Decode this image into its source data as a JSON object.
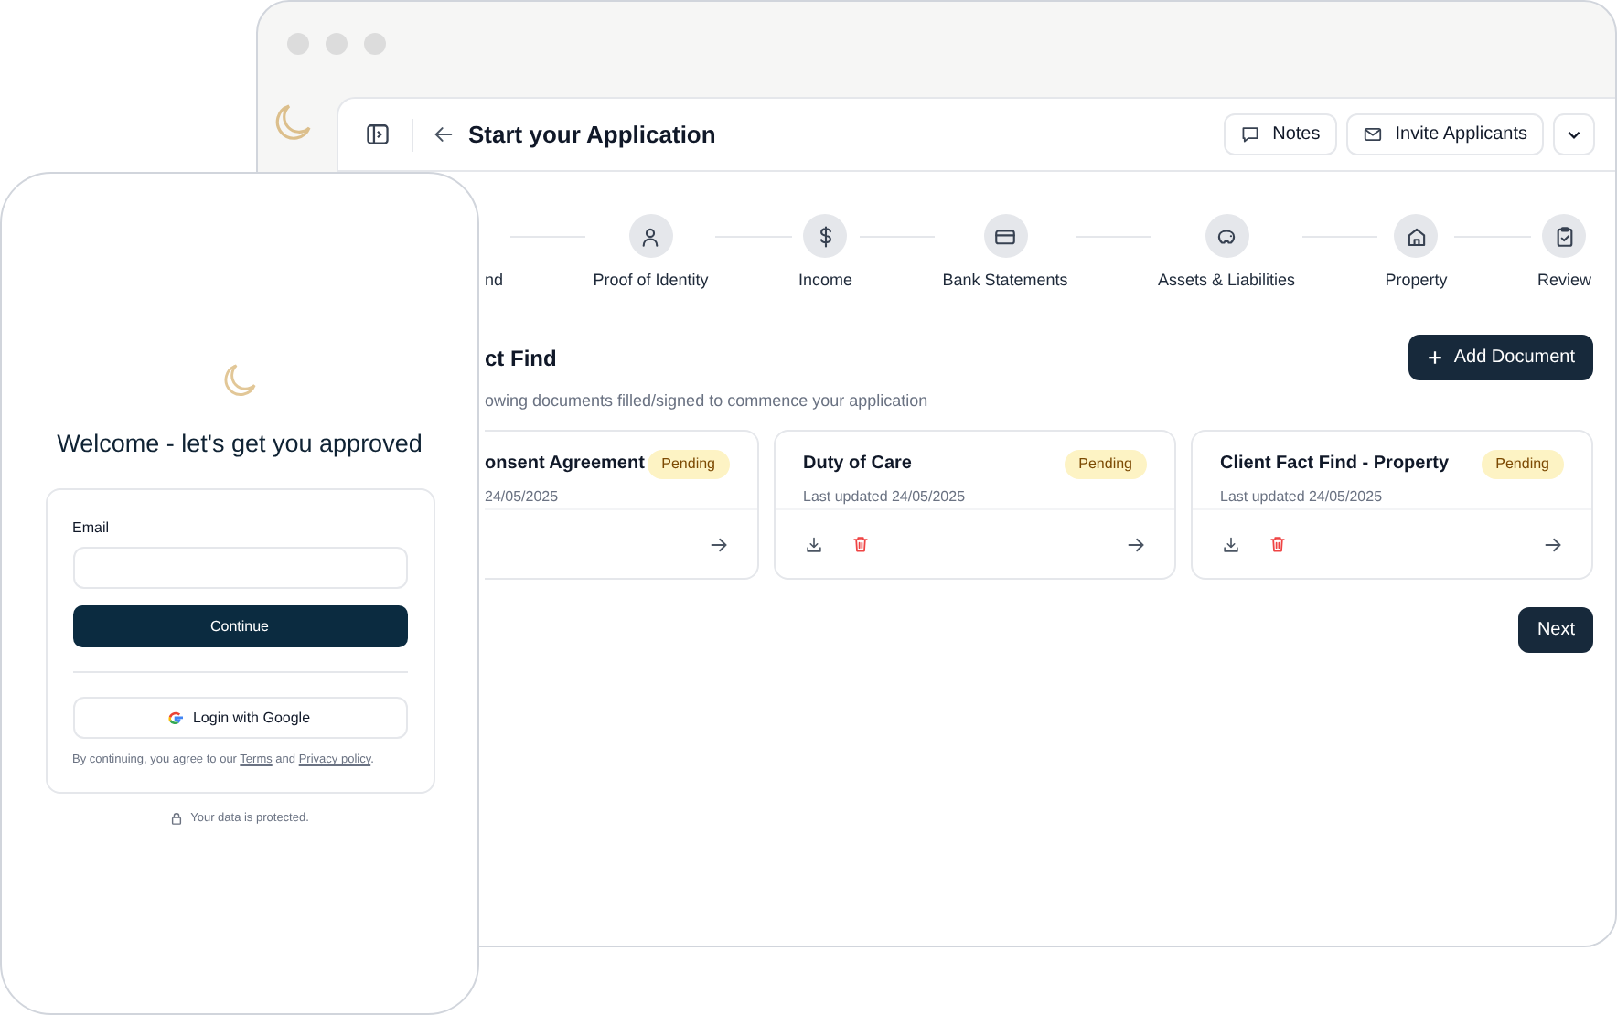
{
  "desktop": {
    "header": {
      "title": "Start your Application",
      "buttons": [
        "Notes",
        "Invite Applicants"
      ]
    },
    "steps": [
      {
        "label": "nd"
      },
      {
        "label": "Proof of Identity"
      },
      {
        "label": "Income"
      },
      {
        "label": "Bank Statements"
      },
      {
        "label": "Assets & Liabilities"
      },
      {
        "label": "Property"
      },
      {
        "label": "Review"
      }
    ],
    "section": {
      "title": "ct Find",
      "subtitle": "owing documents filled/signed to commence your application",
      "add_button": "Add Document"
    },
    "documents": [
      {
        "title": "onsent Agreement",
        "status": "Pending",
        "updated": "24/05/2025",
        "actions_visible": false
      },
      {
        "title": "Duty of Care",
        "status": "Pending",
        "updated": "Last updated 24/05/2025",
        "actions_visible": true
      },
      {
        "title": "Client Fact Find - Property",
        "status": "Pending",
        "updated": "Last updated 24/05/2025",
        "actions_visible": true
      }
    ],
    "next_button": "Next"
  },
  "phone": {
    "title": "Welcome - let's get you approved",
    "email_label": "Email",
    "continue_button": "Continue",
    "google_button": "Login with Google",
    "terms": {
      "before": "By continuing, you agree to our ",
      "links": [
        "Terms",
        "Privacy policy"
      ],
      "middle": " and ",
      "after": "."
    },
    "footer": "Your data is protected."
  }
}
